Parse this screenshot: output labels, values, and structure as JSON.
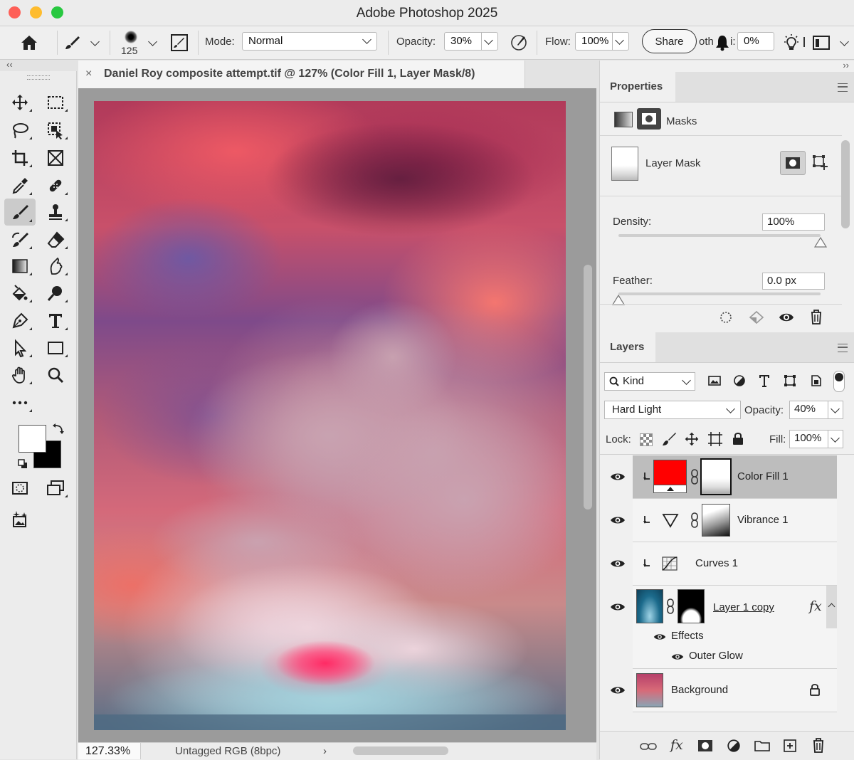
{
  "window": {
    "title": "Adobe Photoshop 2025"
  },
  "options": {
    "brush_size": "125",
    "mode_label": "Mode:",
    "mode_value": "Normal",
    "opacity_label": "Opacity:",
    "opacity_value": "30%",
    "flow_label": "Flow:",
    "flow_value": "100%",
    "share_label": "Share",
    "other_label": "oth",
    "other_suffix": "i:",
    "smoothing_value": "0%"
  },
  "document": {
    "tab_title": "Daniel Roy composite attempt.tif @ 127% (Color Fill 1, Layer Mask/8)",
    "zoom": "127.33%",
    "profile": "Untagged RGB (8bpc)"
  },
  "collapse": {
    "left": "‹‹",
    "right": "››"
  },
  "properties": {
    "tab": "Properties",
    "masks_label": "Masks",
    "layer_mask_label": "Layer Mask",
    "density_label": "Density:",
    "density_value": "100%",
    "density_fraction": 1.0,
    "feather_label": "Feather:",
    "feather_value": "0.0 px",
    "feather_fraction": 0.0
  },
  "layers": {
    "tab": "Layers",
    "kind_label": "Kind",
    "blend_mode": "Hard Light",
    "opacity_label": "Opacity:",
    "opacity_value": "40%",
    "lock_label": "Lock:",
    "fill_label": "Fill:",
    "fill_value": "100%",
    "items": [
      {
        "name": "Color Fill 1",
        "selected": true
      },
      {
        "name": "Vibrance 1"
      },
      {
        "name": "Curves 1"
      },
      {
        "name": "Layer 1 copy",
        "fx": "fx",
        "effects_label": "Effects",
        "effect": "Outer Glow"
      },
      {
        "name": "Background",
        "locked": true
      }
    ]
  },
  "colors": {
    "foreground": "#ffffff",
    "background": "#000000",
    "color_fill_swatch": "#ff0000",
    "traffic_red": "#fe5f57",
    "traffic_yellow": "#febc2e",
    "traffic_green": "#28c840"
  }
}
